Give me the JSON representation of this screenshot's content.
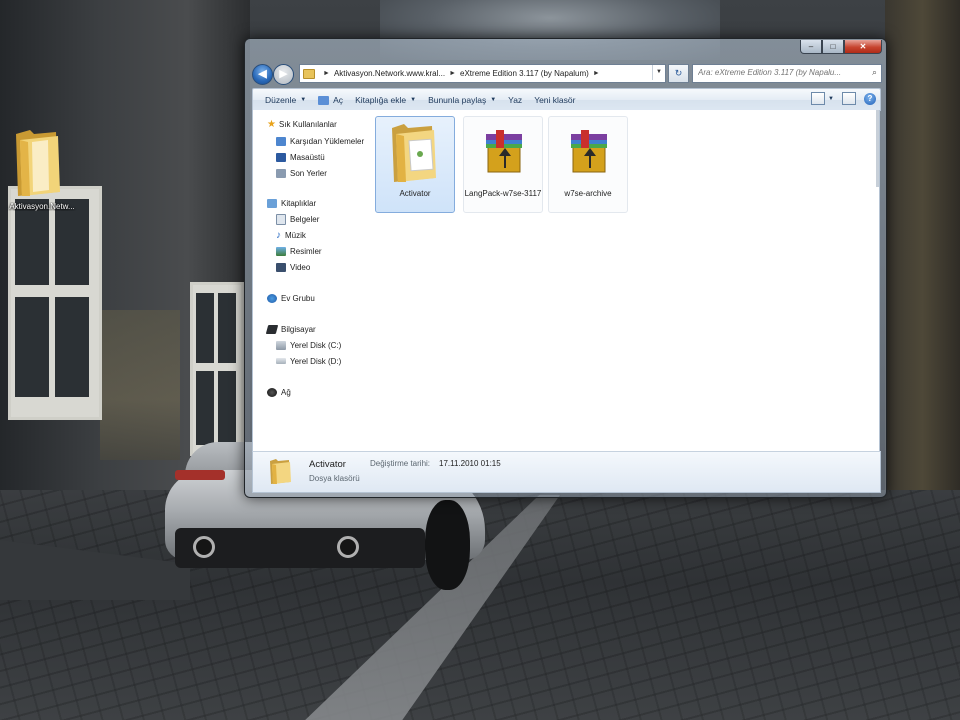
{
  "desktop": {
    "icon_label": "Aktivasyon.Netw..."
  },
  "window": {
    "caption": {
      "minimize": "–",
      "maximize": "□",
      "close": "✕"
    },
    "nav": {
      "back": "◀",
      "forward": "▶",
      "refresh": "↻"
    },
    "address": {
      "crumbs": [
        "Aktivasyon.Network.www.kral...",
        "eXtreme Edition 3.117 (by Napalum)"
      ],
      "separator": "►"
    },
    "search": {
      "placeholder": "Ara: eXtreme Edition 3.117 (by Napalu..."
    }
  },
  "toolbar": {
    "items": [
      {
        "label": "Düzenle",
        "dropdown": true
      },
      {
        "label": "Aç",
        "dropdown": false
      },
      {
        "label": "Kitaplığa ekle",
        "dropdown": true
      },
      {
        "label": "Bununla paylaş",
        "dropdown": true
      },
      {
        "label": "Yaz",
        "dropdown": false
      },
      {
        "label": "Yeni klasör",
        "dropdown": false
      }
    ],
    "help": "?"
  },
  "nav_pane": {
    "favorites": {
      "title": "Sık Kullanılanlar",
      "items": [
        "Karşıdan Yüklemeler",
        "Masaüstü",
        "Son Yerler"
      ]
    },
    "libraries": {
      "title": "Kitaplıklar",
      "items": [
        "Belgeler",
        "Müzik",
        "Resimler",
        "Video"
      ]
    },
    "homegroup": "Ev Grubu",
    "computer": {
      "title": "Bilgisayar",
      "items": [
        "Yerel Disk (C:)",
        "Yerel Disk (D:)"
      ]
    },
    "network": "Ağ"
  },
  "files": [
    {
      "name": "Activator",
      "type": "folder",
      "selected": true
    },
    {
      "name": "LangPack-w7se-3117",
      "type": "winrar"
    },
    {
      "name": "w7se-archive",
      "type": "winrar"
    }
  ],
  "details": {
    "name": "Activator",
    "type": "Dosya klasörü",
    "modified_label": "Değiştirme tarihi:",
    "modified_value": "17.11.2010 01:15"
  },
  "colors": {
    "accent": "#3b77c2",
    "selection": "#cfe3f9",
    "folder": "#e8c35a"
  }
}
